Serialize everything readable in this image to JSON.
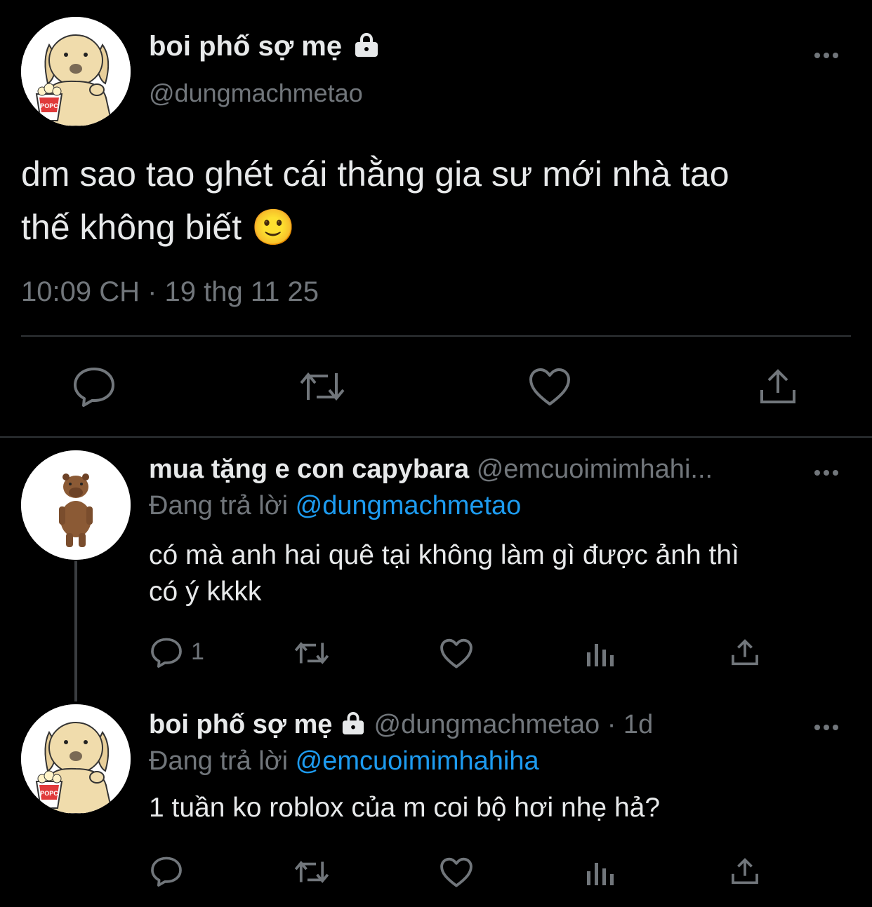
{
  "main_tweet": {
    "display_name": "boi phố sợ mẹ",
    "handle": "@dungmachmetao",
    "text_line1": "dm sao tao ghét cái thằng gia sư mới nhà tao",
    "text_line2": "thế không biết",
    "emoji": "🙂",
    "timestamp": "10:09 CH · 19 thg 11 25",
    "avatar_label": "POPC",
    "icons": [
      "reply-icon",
      "retweet-icon",
      "like-icon",
      "share-icon"
    ]
  },
  "reply1": {
    "display_name": "mua tặng e con capybara",
    "handle": "@emcuoimimhahi...",
    "replying_prefix": "Đang trả lời",
    "replying_to": "@dungmachmetao",
    "text_line1": "có mà anh hai quê tại không làm gì được ảnh thì",
    "text_line2": "có ý kkkk",
    "reply_count": "1"
  },
  "reply2": {
    "display_name": "boi phố sợ mẹ",
    "handle": "@dungmachmetao",
    "time": "· 1d",
    "replying_prefix": "Đang trả lời",
    "replying_to": "@emcuoimimhahiha",
    "text": "1 tuần ko roblox của m coi bộ hơi nhẹ hả?",
    "avatar_label": "POPC"
  },
  "colors": {
    "background": "#000000",
    "text": "#e7e9ea",
    "secondary": "#71767b",
    "accent": "#1d9bf0"
  }
}
